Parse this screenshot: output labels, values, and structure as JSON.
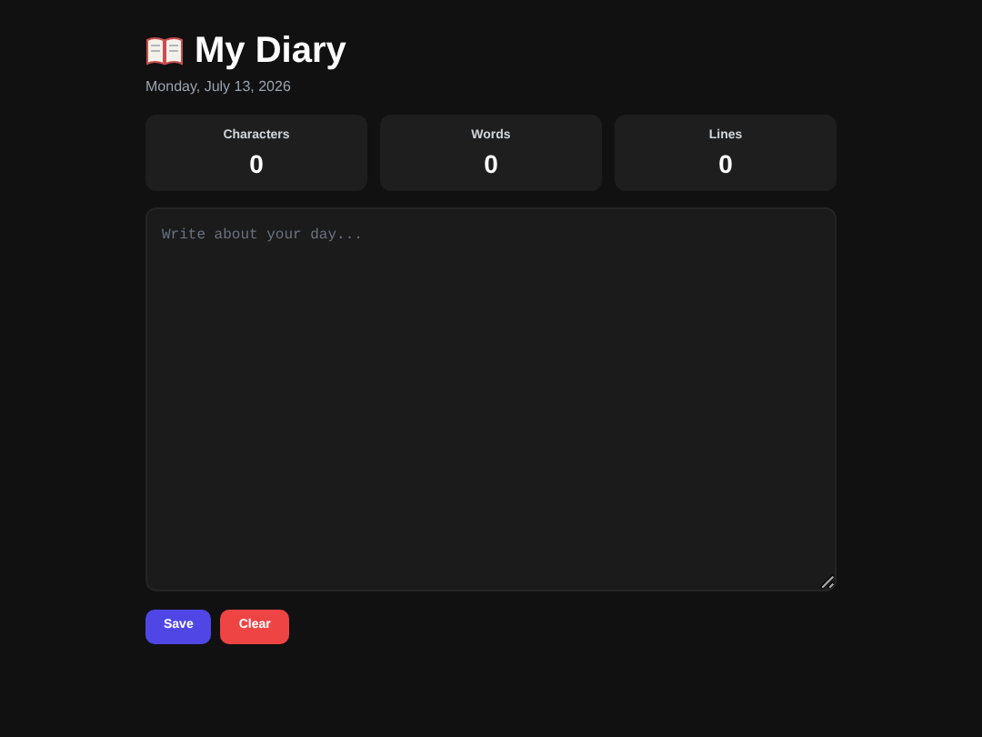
{
  "header": {
    "title": "My Diary",
    "date": "Monday, July 13, 2026"
  },
  "stats": [
    {
      "label": "Characters",
      "value": "0"
    },
    {
      "label": "Words",
      "value": "0"
    },
    {
      "label": "Lines",
      "value": "0"
    }
  ],
  "editor": {
    "placeholder": "Write about your day..."
  },
  "buttons": [
    {
      "label": "Save",
      "kind": "primary"
    },
    {
      "label": "Clear",
      "kind": "danger"
    }
  ]
}
